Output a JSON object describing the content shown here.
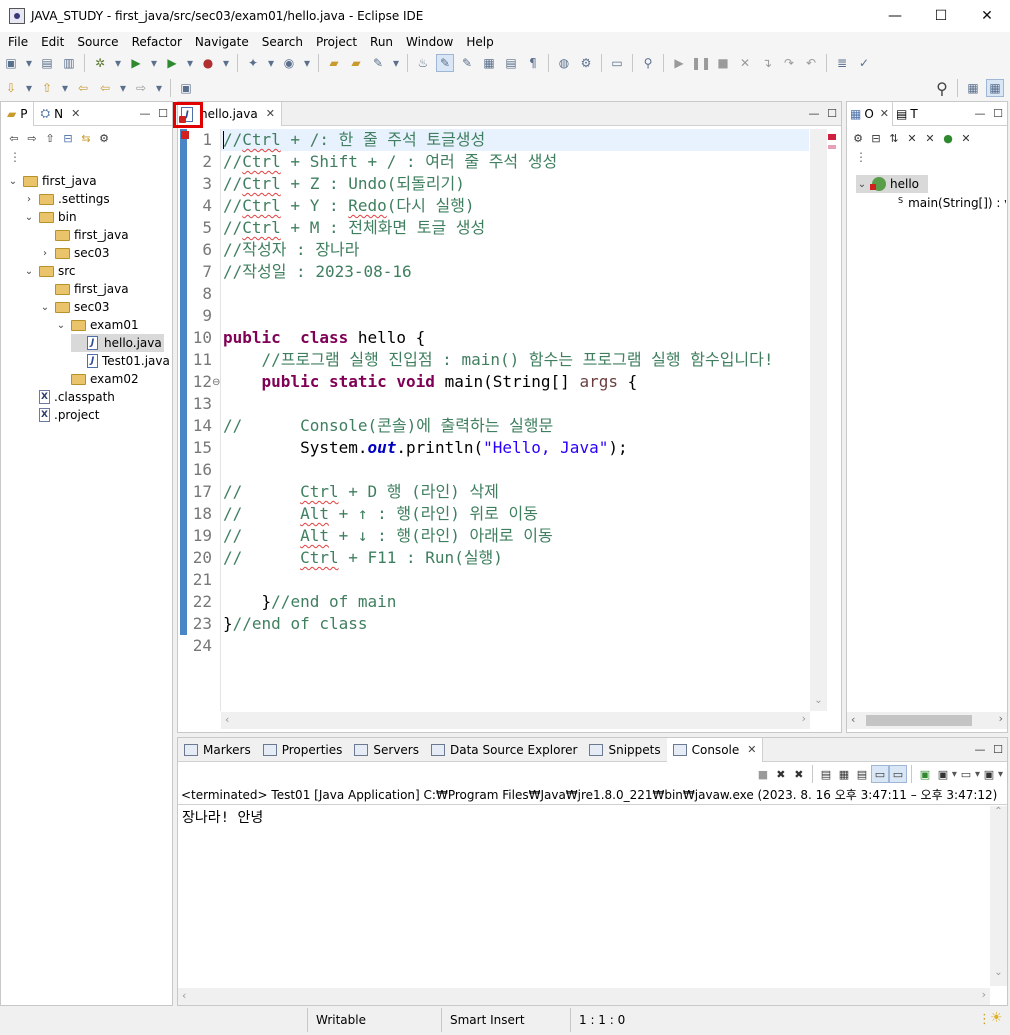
{
  "window": {
    "title": "JAVA_STUDY - first_java/src/sec03/exam01/hello.java - Eclipse IDE",
    "minimize": "—",
    "maximize": "☐",
    "close": "✕"
  },
  "menu": [
    "File",
    "Edit",
    "Source",
    "Refactor",
    "Navigate",
    "Search",
    "Project",
    "Run",
    "Window",
    "Help"
  ],
  "left_panel": {
    "tabs": [
      {
        "label": "P"
      },
      {
        "label": "N"
      }
    ],
    "tree": [
      {
        "label": "first_java",
        "kind": "project",
        "depth": 0,
        "caret": "expanded"
      },
      {
        "label": ".settings",
        "kind": "folder",
        "depth": 1,
        "caret": "collapsed"
      },
      {
        "label": "bin",
        "kind": "folder",
        "depth": 1,
        "caret": "expanded"
      },
      {
        "label": "first_java",
        "kind": "folder",
        "depth": 2,
        "caret": "none"
      },
      {
        "label": "sec03",
        "kind": "folder",
        "depth": 2,
        "caret": "collapsed"
      },
      {
        "label": "src",
        "kind": "folder",
        "depth": 1,
        "caret": "expanded"
      },
      {
        "label": "first_java",
        "kind": "folder",
        "depth": 2,
        "caret": "none"
      },
      {
        "label": "sec03",
        "kind": "folder",
        "depth": 2,
        "caret": "expanded"
      },
      {
        "label": "exam01",
        "kind": "folder",
        "depth": 3,
        "caret": "expanded"
      },
      {
        "label": "hello.java",
        "kind": "java",
        "depth": 4,
        "caret": "none",
        "selected": true
      },
      {
        "label": "Test01.java",
        "kind": "java",
        "depth": 4,
        "caret": "none"
      },
      {
        "label": "exam02",
        "kind": "folder",
        "depth": 3,
        "caret": "none"
      },
      {
        "label": ".classpath",
        "kind": "xml",
        "depth": 1,
        "caret": "none"
      },
      {
        "label": ".project",
        "kind": "xml",
        "depth": 1,
        "caret": "none"
      }
    ]
  },
  "editor": {
    "tab_label": "hello.java",
    "lines": [
      {
        "n": "1",
        "parts": [
          [
            "cm",
            "//"
          ],
          [
            "cm sq",
            "Ctrl"
          ],
          [
            "cm",
            " + /: 한 줄 주석 토글생성"
          ]
        ]
      },
      {
        "n": "2",
        "parts": [
          [
            "cm",
            "//"
          ],
          [
            "cm sq",
            "Ctrl"
          ],
          [
            "cm",
            " + Shift + / : 여러 줄 주석 생성"
          ]
        ]
      },
      {
        "n": "3",
        "parts": [
          [
            "cm",
            "//"
          ],
          [
            "cm sq",
            "Ctrl"
          ],
          [
            "cm",
            " + Z : Undo(되돌리기)"
          ]
        ]
      },
      {
        "n": "4",
        "parts": [
          [
            "cm",
            "//"
          ],
          [
            "cm sq",
            "Ctrl"
          ],
          [
            "cm",
            " + Y : "
          ],
          [
            "cm sq",
            "Redo"
          ],
          [
            "cm",
            "(다시 실행)"
          ]
        ]
      },
      {
        "n": "5",
        "parts": [
          [
            "cm",
            "//"
          ],
          [
            "cm sq",
            "Ctrl"
          ],
          [
            "cm",
            " + M : 전체화면 토글 생성"
          ]
        ]
      },
      {
        "n": "6",
        "parts": [
          [
            "cm",
            "//작성자 : 장나라"
          ]
        ]
      },
      {
        "n": "7",
        "parts": [
          [
            "cm",
            "//작성일 : 2023-08-16"
          ]
        ]
      },
      {
        "n": "8",
        "parts": []
      },
      {
        "n": "9",
        "parts": []
      },
      {
        "n": "10",
        "parts": [
          [
            "kw",
            "public"
          ],
          [
            "",
            "  "
          ],
          [
            "kw",
            "class"
          ],
          [
            "",
            " hello {"
          ]
        ]
      },
      {
        "n": "11",
        "parts": [
          [
            "",
            " "
          ],
          [
            "cm",
            "   //프로그램 실행 진입점 : main() 함수는 프로그램 실행 함수입니다!"
          ]
        ]
      },
      {
        "n": "12",
        "parts": [
          [
            "",
            "    "
          ],
          [
            "kw",
            "public"
          ],
          [
            "",
            " "
          ],
          [
            "kw",
            "static"
          ],
          [
            "",
            " "
          ],
          [
            "kw",
            "void"
          ],
          [
            "",
            " main(String[] "
          ],
          [
            "par",
            "args"
          ],
          [
            "",
            " {"
          ]
        ]
      },
      {
        "n": "13",
        "parts": []
      },
      {
        "n": "14",
        "parts": [
          [
            "cm",
            "//      Console(콘솔)에 출력하는 실행문"
          ]
        ]
      },
      {
        "n": "15",
        "parts": [
          [
            "",
            "        System."
          ],
          [
            "fld",
            "out"
          ],
          [
            "",
            ".println("
          ],
          [
            "str",
            "\"Hello, Java\""
          ],
          [
            "",
            ");"
          ]
        ]
      },
      {
        "n": "16",
        "parts": []
      },
      {
        "n": "17",
        "parts": [
          [
            "cm",
            "//      "
          ],
          [
            "cm sq",
            "Ctrl"
          ],
          [
            "cm",
            " + D 행 (라인) 삭제"
          ]
        ]
      },
      {
        "n": "18",
        "parts": [
          [
            "cm",
            "//      "
          ],
          [
            "cm sq",
            "Alt"
          ],
          [
            "cm",
            " + ↑ : 행(라인) 위로 이동"
          ]
        ]
      },
      {
        "n": "19",
        "parts": [
          [
            "cm",
            "//      "
          ],
          [
            "cm sq",
            "Alt"
          ],
          [
            "cm",
            " + ↓ : 행(라인) 아래로 이동"
          ]
        ]
      },
      {
        "n": "20",
        "parts": [
          [
            "cm",
            "//      "
          ],
          [
            "cm sq",
            "Ctrl"
          ],
          [
            "cm",
            " + F11 : Run(실행)"
          ]
        ]
      },
      {
        "n": "21",
        "parts": []
      },
      {
        "n": "22",
        "parts": [
          [
            "",
            "    }"
          ],
          [
            "cm",
            "//end of main"
          ]
        ]
      },
      {
        "n": "23",
        "parts": [
          [
            "",
            "}"
          ],
          [
            "cm",
            "//end of class"
          ]
        ]
      },
      {
        "n": "24",
        "parts": []
      }
    ]
  },
  "outline": {
    "tabs": [
      {
        "label": "O"
      },
      {
        "label": "T"
      }
    ],
    "class_name": "hello",
    "method": "main(String[]) : v",
    "method_modifier": "S"
  },
  "bottom": {
    "tabs": [
      "Markers",
      "Properties",
      "Servers",
      "Data Source Explorer",
      "Snippets",
      "Console"
    ],
    "console_header": "<terminated> Test01 [Java Application] C:₩Program Files₩Java₩jre1.8.0_221₩bin₩javaw.exe  (2023. 8. 16 오후 3:47:11 – 오후 3:47:12)",
    "console_output": "장나라!  안녕"
  },
  "status": {
    "writable": "Writable",
    "insert_mode": "Smart Insert",
    "position": "1 : 1 : 0"
  },
  "colors": {
    "comment": "#3f7f5f",
    "keyword": "#7f0055",
    "string": "#2a00ff",
    "highlight_box": "#e00000"
  }
}
